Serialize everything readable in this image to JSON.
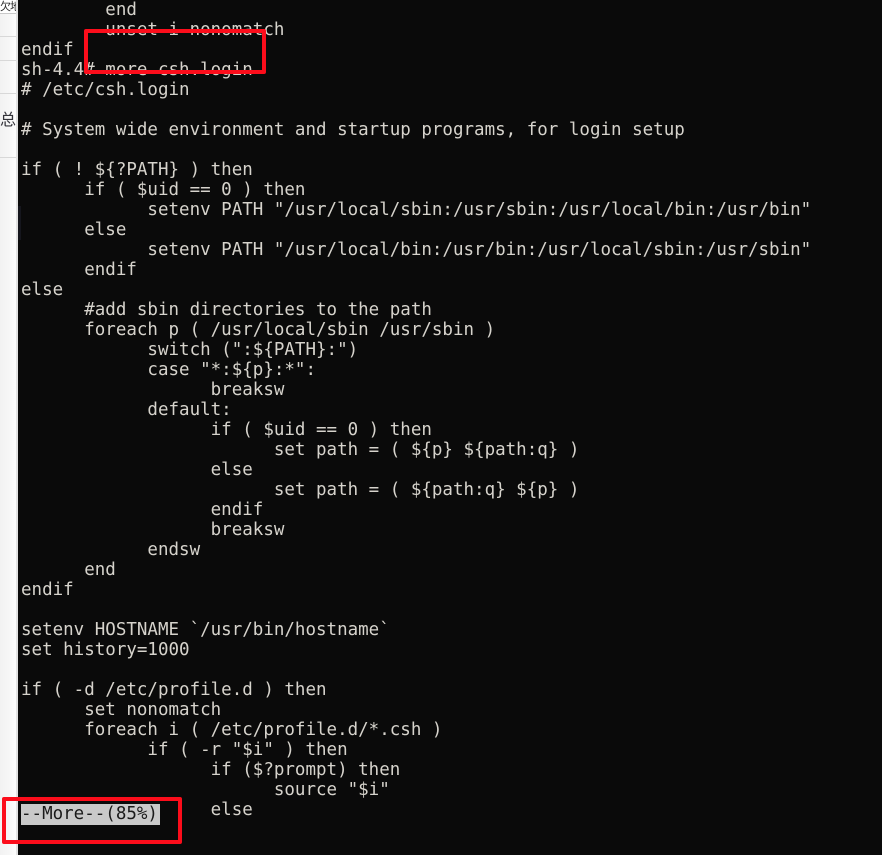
{
  "background_app": {
    "name": "partially-occluded-window",
    "titlebar_text": "欠地",
    "sidebar_glyphs": "总\n人"
  },
  "terminal": {
    "prompt_line": "sh-4.4# more csh.login",
    "shell_prompt": "sh-4.4#",
    "command": "more csh.login",
    "file_being_paged": "csh.login",
    "background_color": "#0a0a0a",
    "foreground_color": "#d6d3cc",
    "lines": [
      "        end",
      "        unset i nonomatch",
      "endif",
      "sh-4.4# more csh.login",
      "# /etc/csh.login",
      "",
      "# System wide environment and startup programs, for login setup",
      "",
      "if ( ! ${?PATH} ) then",
      "      if ( $uid == 0 ) then",
      "            setenv PATH \"/usr/local/sbin:/usr/sbin:/usr/local/bin:/usr/bin\"",
      "      else",
      "            setenv PATH \"/usr/local/bin:/usr/bin:/usr/local/sbin:/usr/sbin\"",
      "      endif",
      "else",
      "      #add sbin directories to the path",
      "      foreach p ( /usr/local/sbin /usr/sbin )",
      "            switch (\":${PATH}:\")",
      "            case \"*:${p}:*\":",
      "                  breaksw",
      "            default:",
      "                  if ( $uid == 0 ) then",
      "                        set path = ( ${p} ${path:q} )",
      "                  else",
      "                        set path = ( ${path:q} ${p} )",
      "                  endif",
      "                  breaksw",
      "            endsw",
      "      end",
      "endif",
      "",
      "setenv HOSTNAME `/usr/bin/hostname`",
      "set history=1000",
      "",
      "if ( -d /etc/profile.d ) then",
      "      set nonomatch",
      "      foreach i ( /etc/profile.d/*.csh )",
      "            if ( -r \"$i\" ) then",
      "                  if ($?prompt) then",
      "                        source \"$i\"",
      "                  else"
    ],
    "more_prompt": {
      "text": "--More--(85%)",
      "percent": "85%",
      "background_color": "#c9c9c9",
      "foreground_color": "#1a1a1a"
    }
  },
  "annotations": {
    "color": "#fc0d1b",
    "boxes": [
      {
        "label": "highlight-command-more-csh-login"
      },
      {
        "label": "highlight-more-pager-prompt"
      }
    ]
  }
}
